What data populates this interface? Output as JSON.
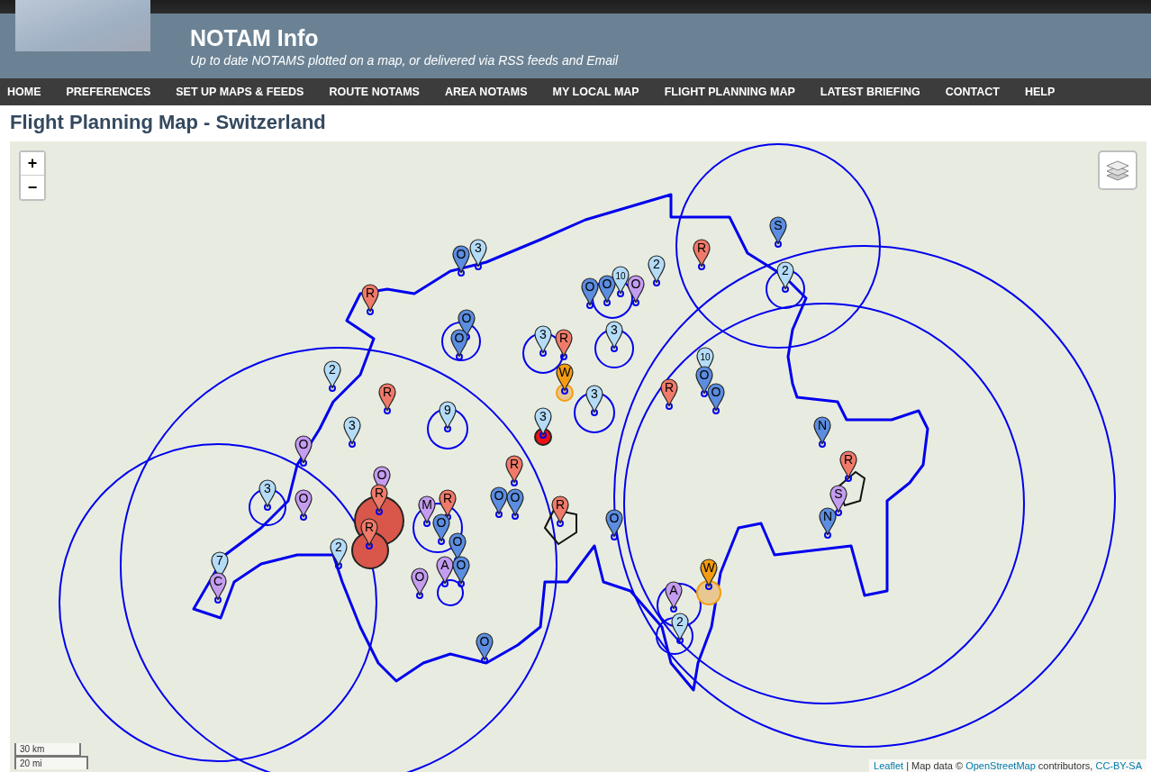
{
  "header": {
    "title": "NOTAM Info",
    "tagline": "Up to date NOTAMS plotted on a map, or delivered via RSS feeds and Email"
  },
  "nav": [
    "HOME",
    "PREFERENCES",
    "SET UP MAPS & FEEDS",
    "ROUTE NOTAMS",
    "AREA NOTAMS",
    "MY LOCAL MAP",
    "FLIGHT PLANNING MAP",
    "LATEST BRIEFING",
    "CONTACT",
    "HELP"
  ],
  "page_title": "Flight Planning Map - Switzerland",
  "map": {
    "zoom_in": "+",
    "zoom_out": "−",
    "scale": [
      "30 km",
      "20 mi"
    ],
    "attribution": [
      {
        "kind": "link",
        "text": "Leaflet"
      },
      {
        "kind": "text",
        "text": " | Map data © "
      },
      {
        "kind": "link",
        "text": "OpenStreetMap"
      },
      {
        "kind": "text",
        "text": " contributors, "
      },
      {
        "kind": "link",
        "text": "CC-BY-SA"
      }
    ],
    "markers": [
      {
        "label": "O",
        "color": "#5b8de0"
      },
      {
        "label": "3",
        "color": "#b4dcf8"
      },
      {
        "label": "R",
        "color": "#f07a6a"
      },
      {
        "label": "O",
        "color": "#5b8de0"
      },
      {
        "label": "O",
        "color": "#5b8de0"
      },
      {
        "label": "2",
        "color": "#b4dcf8"
      },
      {
        "label": "R",
        "color": "#f07a6a"
      },
      {
        "label": "3",
        "color": "#b4dcf8"
      },
      {
        "label": "9",
        "color": "#b4dcf8"
      },
      {
        "label": "3",
        "color": "#b4dcf8"
      },
      {
        "label": "R",
        "color": "#f07a6a"
      },
      {
        "label": "W",
        "color": "#f39c12"
      },
      {
        "label": "3",
        "color": "#b4dcf8"
      },
      {
        "label": "3",
        "color": "#b4dcf8"
      },
      {
        "label": "3",
        "color": "#b4dcf8"
      },
      {
        "label": "O",
        "color": "#5b8de0"
      },
      {
        "label": "O",
        "color": "#5b8de0"
      },
      {
        "label": "10",
        "color": "#b4dcf8"
      },
      {
        "label": "O",
        "color": "#c49cf0"
      },
      {
        "label": "2",
        "color": "#b4dcf8"
      },
      {
        "label": "R",
        "color": "#f07a6a"
      },
      {
        "label": "S",
        "color": "#5b8de0"
      },
      {
        "label": "2",
        "color": "#b4dcf8"
      },
      {
        "label": "R",
        "color": "#f07a6a"
      },
      {
        "label": "10",
        "color": "#b4dcf8"
      },
      {
        "label": "O",
        "color": "#5b8de0"
      },
      {
        "label": "O",
        "color": "#5b8de0"
      },
      {
        "label": "N",
        "color": "#5b8de0"
      },
      {
        "label": "R",
        "color": "#f07a6a"
      },
      {
        "label": "S",
        "color": "#c49cf0"
      },
      {
        "label": "N",
        "color": "#5b8de0"
      },
      {
        "label": "O",
        "color": "#c49cf0"
      },
      {
        "label": "3",
        "color": "#b4dcf8"
      },
      {
        "label": "O",
        "color": "#c49cf0"
      },
      {
        "label": "O",
        "color": "#c49cf0"
      },
      {
        "label": "R",
        "color": "#f07a6a"
      },
      {
        "label": "R",
        "color": "#f07a6a"
      },
      {
        "label": "M",
        "color": "#c49cf0"
      },
      {
        "label": "R",
        "color": "#f07a6a"
      },
      {
        "label": "O",
        "color": "#5b8de0"
      },
      {
        "label": "O",
        "color": "#5b8de0"
      },
      {
        "label": "O",
        "color": "#c49cf0"
      },
      {
        "label": "A",
        "color": "#c49cf0"
      },
      {
        "label": "O",
        "color": "#5b8de0"
      },
      {
        "label": "R",
        "color": "#f07a6a"
      },
      {
        "label": "O",
        "color": "#5b8de0"
      },
      {
        "label": "O",
        "color": "#5b8de0"
      },
      {
        "label": "R",
        "color": "#f07a6a"
      },
      {
        "label": "O",
        "color": "#5b8de0"
      },
      {
        "label": "2",
        "color": "#b4dcf8"
      },
      {
        "label": "7",
        "color": "#b4dcf8"
      },
      {
        "label": "C",
        "color": "#c49cf0"
      },
      {
        "label": "W",
        "color": "#f39c12"
      },
      {
        "label": "A",
        "color": "#c49cf0"
      },
      {
        "label": "2",
        "color": "#b4dcf8"
      },
      {
        "label": "O",
        "color": "#5b8de0"
      }
    ]
  }
}
